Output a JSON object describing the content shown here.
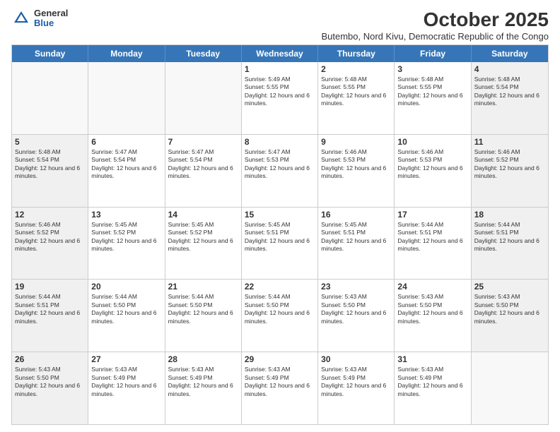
{
  "header": {
    "logo_general": "General",
    "logo_blue": "Blue",
    "month_title": "October 2025",
    "subtitle": "Butembo, Nord Kivu, Democratic Republic of the Congo"
  },
  "days_of_week": [
    "Sunday",
    "Monday",
    "Tuesday",
    "Wednesday",
    "Thursday",
    "Friday",
    "Saturday"
  ],
  "rows": [
    [
      {
        "day": "",
        "empty": true
      },
      {
        "day": "",
        "empty": true
      },
      {
        "day": "",
        "empty": true
      },
      {
        "day": "1",
        "sunrise": "5:49 AM",
        "sunset": "5:55 PM",
        "daylight": "12 hours and 6 minutes."
      },
      {
        "day": "2",
        "sunrise": "5:48 AM",
        "sunset": "5:55 PM",
        "daylight": "12 hours and 6 minutes."
      },
      {
        "day": "3",
        "sunrise": "5:48 AM",
        "sunset": "5:55 PM",
        "daylight": "12 hours and 6 minutes."
      },
      {
        "day": "4",
        "sunrise": "5:48 AM",
        "sunset": "5:54 PM",
        "daylight": "12 hours and 6 minutes."
      }
    ],
    [
      {
        "day": "5",
        "sunrise": "5:48 AM",
        "sunset": "5:54 PM",
        "daylight": "12 hours and 6 minutes."
      },
      {
        "day": "6",
        "sunrise": "5:47 AM",
        "sunset": "5:54 PM",
        "daylight": "12 hours and 6 minutes."
      },
      {
        "day": "7",
        "sunrise": "5:47 AM",
        "sunset": "5:54 PM",
        "daylight": "12 hours and 6 minutes."
      },
      {
        "day": "8",
        "sunrise": "5:47 AM",
        "sunset": "5:53 PM",
        "daylight": "12 hours and 6 minutes."
      },
      {
        "day": "9",
        "sunrise": "5:46 AM",
        "sunset": "5:53 PM",
        "daylight": "12 hours and 6 minutes."
      },
      {
        "day": "10",
        "sunrise": "5:46 AM",
        "sunset": "5:53 PM",
        "daylight": "12 hours and 6 minutes."
      },
      {
        "day": "11",
        "sunrise": "5:46 AM",
        "sunset": "5:52 PM",
        "daylight": "12 hours and 6 minutes."
      }
    ],
    [
      {
        "day": "12",
        "sunrise": "5:46 AM",
        "sunset": "5:52 PM",
        "daylight": "12 hours and 6 minutes."
      },
      {
        "day": "13",
        "sunrise": "5:45 AM",
        "sunset": "5:52 PM",
        "daylight": "12 hours and 6 minutes."
      },
      {
        "day": "14",
        "sunrise": "5:45 AM",
        "sunset": "5:52 PM",
        "daylight": "12 hours and 6 minutes."
      },
      {
        "day": "15",
        "sunrise": "5:45 AM",
        "sunset": "5:51 PM",
        "daylight": "12 hours and 6 minutes."
      },
      {
        "day": "16",
        "sunrise": "5:45 AM",
        "sunset": "5:51 PM",
        "daylight": "12 hours and 6 minutes."
      },
      {
        "day": "17",
        "sunrise": "5:44 AM",
        "sunset": "5:51 PM",
        "daylight": "12 hours and 6 minutes."
      },
      {
        "day": "18",
        "sunrise": "5:44 AM",
        "sunset": "5:51 PM",
        "daylight": "12 hours and 6 minutes."
      }
    ],
    [
      {
        "day": "19",
        "sunrise": "5:44 AM",
        "sunset": "5:51 PM",
        "daylight": "12 hours and 6 minutes."
      },
      {
        "day": "20",
        "sunrise": "5:44 AM",
        "sunset": "5:50 PM",
        "daylight": "12 hours and 6 minutes."
      },
      {
        "day": "21",
        "sunrise": "5:44 AM",
        "sunset": "5:50 PM",
        "daylight": "12 hours and 6 minutes."
      },
      {
        "day": "22",
        "sunrise": "5:44 AM",
        "sunset": "5:50 PM",
        "daylight": "12 hours and 6 minutes."
      },
      {
        "day": "23",
        "sunrise": "5:43 AM",
        "sunset": "5:50 PM",
        "daylight": "12 hours and 6 minutes."
      },
      {
        "day": "24",
        "sunrise": "5:43 AM",
        "sunset": "5:50 PM",
        "daylight": "12 hours and 6 minutes."
      },
      {
        "day": "25",
        "sunrise": "5:43 AM",
        "sunset": "5:50 PM",
        "daylight": "12 hours and 6 minutes."
      }
    ],
    [
      {
        "day": "26",
        "sunrise": "5:43 AM",
        "sunset": "5:50 PM",
        "daylight": "12 hours and 6 minutes."
      },
      {
        "day": "27",
        "sunrise": "5:43 AM",
        "sunset": "5:49 PM",
        "daylight": "12 hours and 6 minutes."
      },
      {
        "day": "28",
        "sunrise": "5:43 AM",
        "sunset": "5:49 PM",
        "daylight": "12 hours and 6 minutes."
      },
      {
        "day": "29",
        "sunrise": "5:43 AM",
        "sunset": "5:49 PM",
        "daylight": "12 hours and 6 minutes."
      },
      {
        "day": "30",
        "sunrise": "5:43 AM",
        "sunset": "5:49 PM",
        "daylight": "12 hours and 6 minutes."
      },
      {
        "day": "31",
        "sunrise": "5:43 AM",
        "sunset": "5:49 PM",
        "daylight": "12 hours and 6 minutes."
      },
      {
        "day": "",
        "empty": true
      }
    ]
  ]
}
